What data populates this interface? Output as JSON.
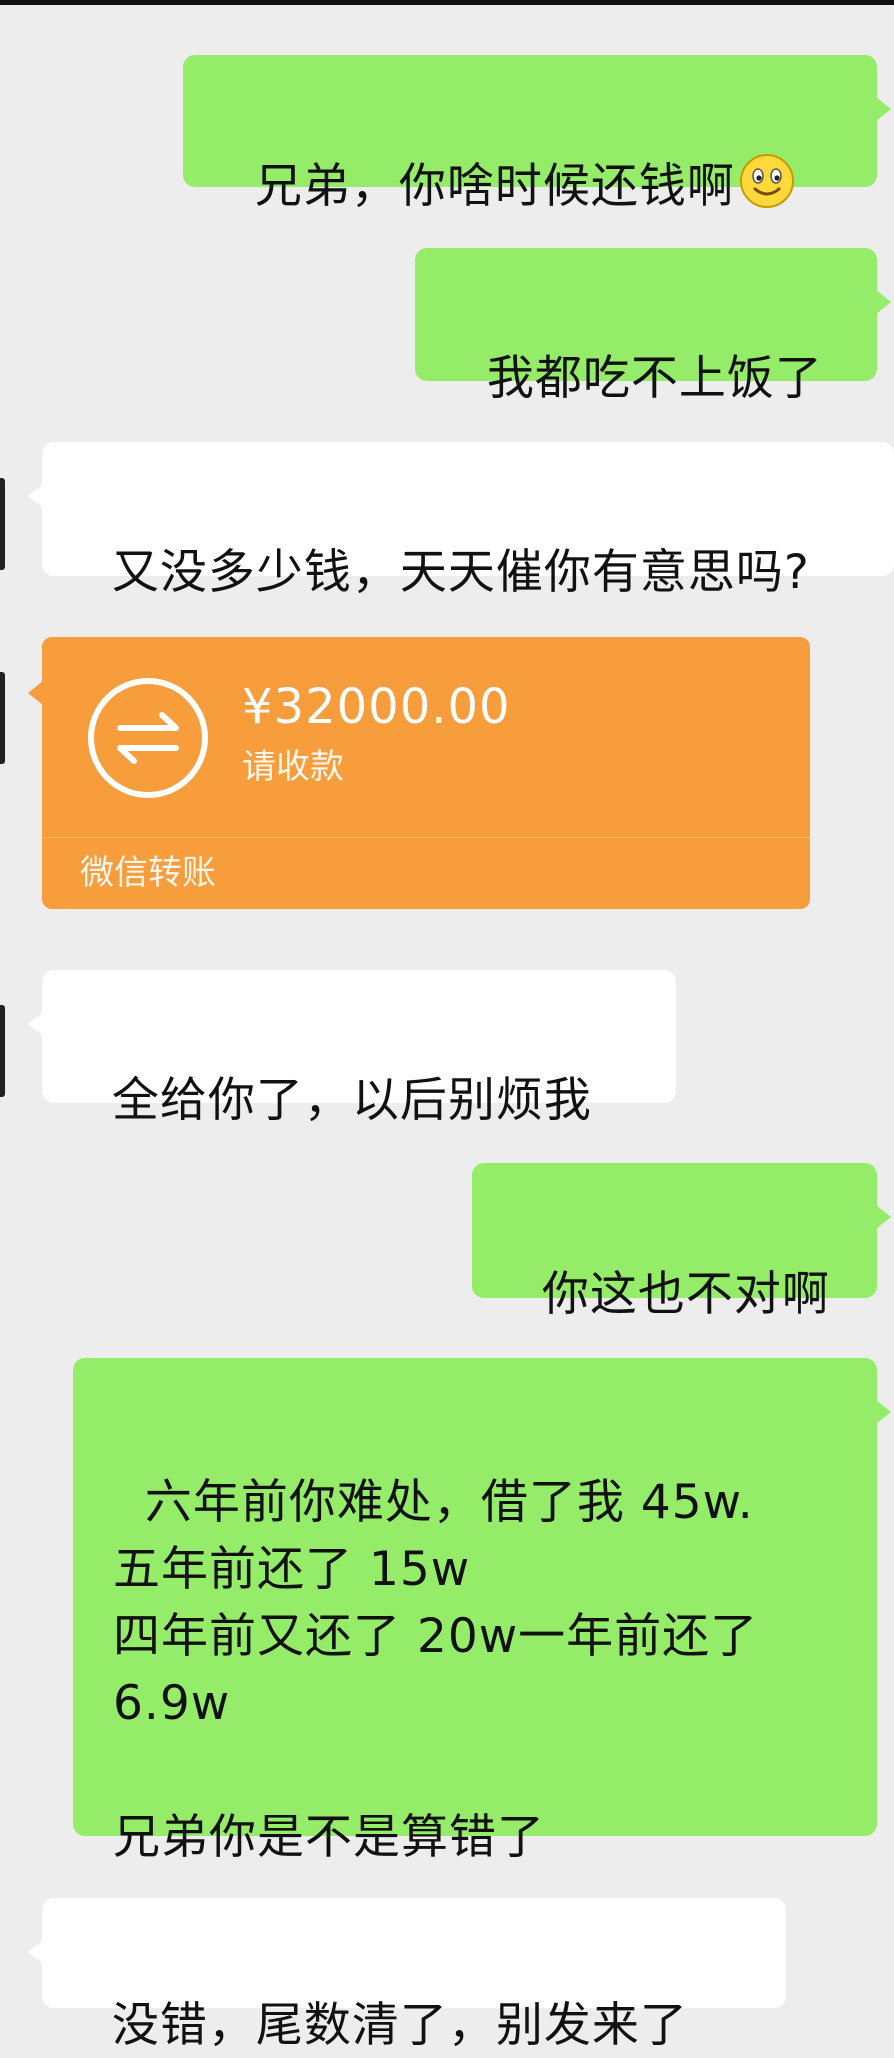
{
  "chat": {
    "msg1": "兄弟，你啥时候还钱啊",
    "msg1_emoji": "smiley-emoji",
    "msg2": "我都吃不上饭了",
    "msg3": "又没多少钱，天天催你有意思吗?",
    "transfer": {
      "amount": "¥32000.00",
      "status": "请收款",
      "label": "微信转账",
      "icon": "transfer-arrows-icon",
      "color": "#f79d3c"
    },
    "msg4": "全给你了，以后别烦我",
    "msg5": "你这也不对啊",
    "msg6": "六年前你难处，借了我 45w.\n五年前还了 15w\n四年前又还了 20w一年前还了\n6.9w\n\n兄弟你是不是算错了",
    "msg7": "没错，尾数清了，别发来了"
  },
  "colors": {
    "sent_bubble": "#95ec69",
    "received_bubble": "#ffffff",
    "background": "#ededed"
  }
}
